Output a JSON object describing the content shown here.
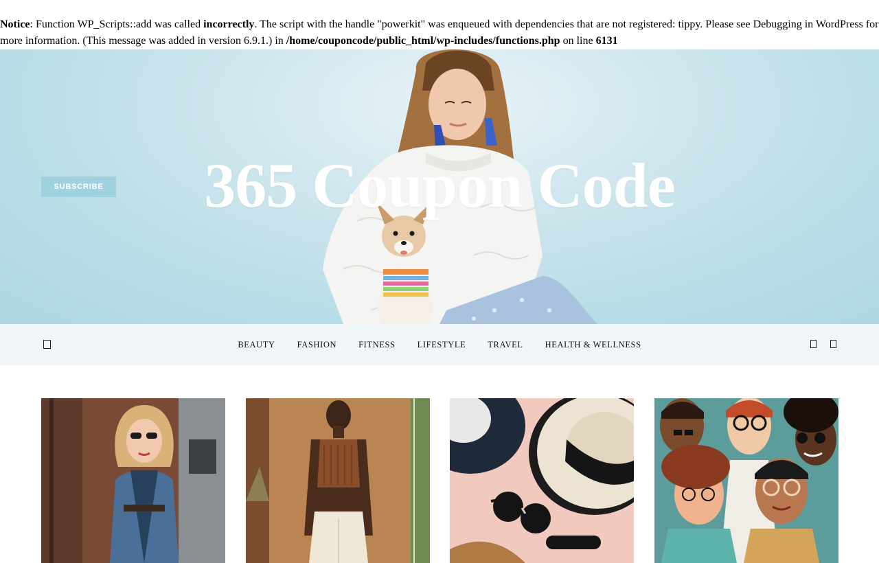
{
  "notice": {
    "label": "Notice",
    "part1": ": Function WP_Scripts::add was called ",
    "bold1": "incorrectly",
    "part2": ". The script with the handle \"powerkit\" was enqueued with dependencies that are not registered: tippy. Please see Debugging in WordPress for more information. (This message was added in version 6.9.1.) in ",
    "path": "/home/couponcode/public_html/wp-includes/functions.php",
    "part3": " on line ",
    "line": "6131"
  },
  "hero": {
    "subscribe_label": "SUBSCRIBE",
    "site_title": "365 Coupon Code"
  },
  "nav": {
    "items": [
      "BEAUTY",
      "FASHION",
      "FITNESS",
      "LIFESTYLE",
      "TRAVEL",
      "HEALTH & WELLNESS"
    ],
    "menu_icon": "menu-icon",
    "right_icons": [
      "search-icon",
      "bookmark-icon"
    ]
  },
  "posts": [
    {
      "image": "woman-denim-jacket-sunglasses"
    },
    {
      "image": "woman-brown-crop-top"
    },
    {
      "image": "hats-and-sunglasses"
    },
    {
      "image": "illustrated-diverse-people"
    }
  ],
  "colors": {
    "hero_bg": "#b9dde6",
    "subscribe_bg": "#9fd2de",
    "nav_bg": "#f1f6f9",
    "title": "#ffffff"
  }
}
